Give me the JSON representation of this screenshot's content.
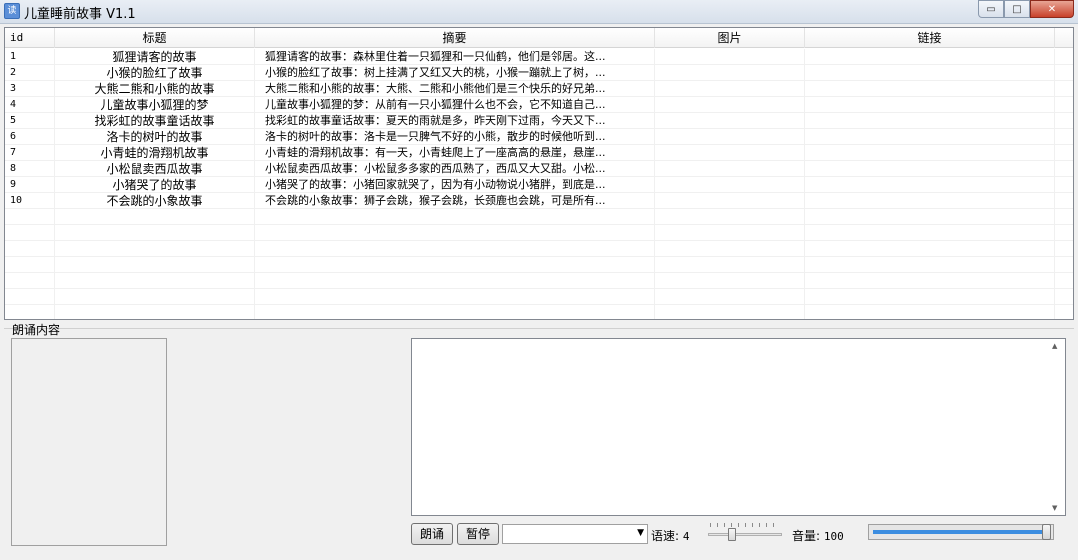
{
  "window": {
    "title": "儿童睡前故事 V1.1",
    "app_icon_glyph": "读",
    "minimize_glyph": "▭",
    "maximize_glyph": "□",
    "close_glyph": "✕"
  },
  "grid": {
    "headers": {
      "id": "id",
      "title": "标题",
      "summary": "摘要",
      "image": "图片",
      "link": "链接"
    },
    "rows": [
      {
        "id": "1",
        "title": "狐狸请客的故事",
        "summary": "狐狸请客的故事：森林里住着一只狐狸和一只仙鹤，他们是邻居。这...",
        "image": "",
        "link": ""
      },
      {
        "id": "2",
        "title": "小猴的脸红了故事",
        "summary": "小猴的脸红了故事：树上挂满了又红又大的桃，小猴一蹦就上了树，...",
        "image": "",
        "link": ""
      },
      {
        "id": "3",
        "title": "大熊二熊和小熊的故事",
        "summary": "大熊二熊和小熊的故事：大熊、二熊和小熊他们是三个快乐的好兄弟...",
        "image": "",
        "link": ""
      },
      {
        "id": "4",
        "title": "儿童故事小狐狸的梦",
        "summary": "儿童故事小狐狸的梦：从前有一只小狐狸什么也不会，它不知道自己...",
        "image": "",
        "link": ""
      },
      {
        "id": "5",
        "title": "找彩虹的故事童话故事",
        "summary": "找彩虹的故事童话故事：夏天的雨就是多，昨天刚下过雨，今天又下...",
        "image": "",
        "link": ""
      },
      {
        "id": "6",
        "title": "洛卡的树叶的故事",
        "summary": "洛卡的树叶的故事：洛卡是一只脾气不好的小熊，散步的时候他听到...",
        "image": "",
        "link": ""
      },
      {
        "id": "7",
        "title": "小青蛙的滑翔机故事",
        "summary": "小青蛙的滑翔机故事：有一天，小青蛙爬上了一座高高的悬崖，悬崖...",
        "image": "",
        "link": ""
      },
      {
        "id": "8",
        "title": "小松鼠卖西瓜故事",
        "summary": "小松鼠卖西瓜故事：小松鼠多多家的西瓜熟了，西瓜又大又甜。小松...",
        "image": "",
        "link": ""
      },
      {
        "id": "9",
        "title": "小猪哭了的故事",
        "summary": "小猪哭了的故事：小猪回家就哭了，因为有小动物说小猪胖，到底是...",
        "image": "",
        "link": ""
      },
      {
        "id": "10",
        "title": "不会跳的小象故事",
        "summary": "不会跳的小象故事：狮子会跳，猴子会跳，长颈鹿也会跳，可是所有...",
        "image": "",
        "link": ""
      }
    ]
  },
  "reading": {
    "group_label": "朗诵内容",
    "content_text": "",
    "read_button": "朗诵",
    "pause_button": "暂停",
    "voice_select_value": "",
    "speed_label": "语速:",
    "speed_value": "4",
    "speed_fraction": 0.3,
    "volume_label": "音量:",
    "volume_value": "100",
    "volume_fraction": 1.0,
    "accent_color": "#3c8de0",
    "scroll_up_glyph": "▲",
    "scroll_down_glyph": "▼",
    "dropdown_glyph": "▼"
  }
}
